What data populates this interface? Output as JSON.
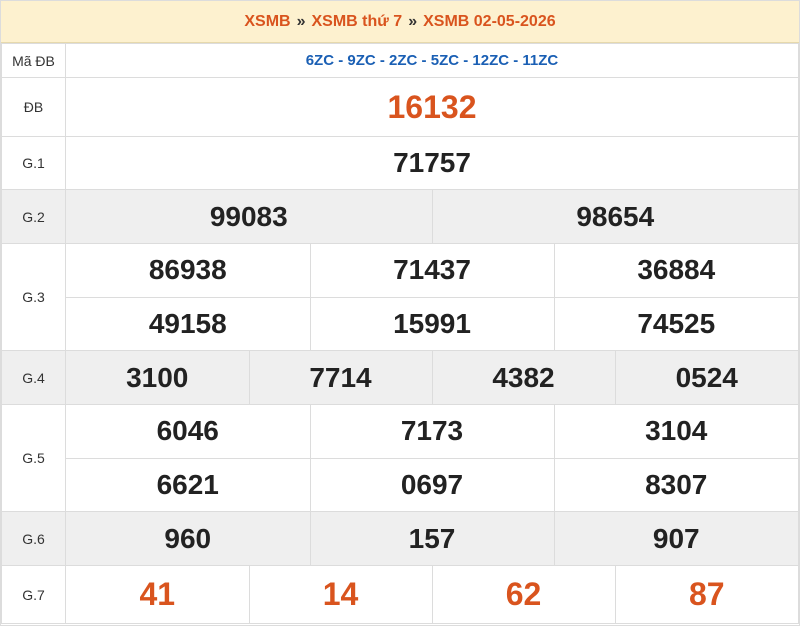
{
  "breadcrumb": {
    "home": "XSMB",
    "sep1": "»",
    "day": "XSMB thứ 7",
    "sep2": "»",
    "date": "XSMB 02-05-2026"
  },
  "rows": {
    "ma_db": {
      "label": "Mã ĐB",
      "value": "6ZC - 9ZC - 2ZC - 5ZC - 12ZC - 11ZC"
    },
    "db": {
      "label": "ĐB",
      "values": [
        "16132"
      ]
    },
    "g1": {
      "label": "G.1",
      "values": [
        "71757"
      ]
    },
    "g2": {
      "label": "G.2",
      "values": [
        "99083",
        "98654"
      ]
    },
    "g3": {
      "label": "G.3",
      "values": [
        "86938",
        "71437",
        "36884",
        "49158",
        "15991",
        "74525"
      ]
    },
    "g4": {
      "label": "G.4",
      "values": [
        "3100",
        "7714",
        "4382",
        "0524"
      ]
    },
    "g5": {
      "label": "G.5",
      "values": [
        "6046",
        "7173",
        "3104",
        "6621",
        "0697",
        "8307"
      ]
    },
    "g6": {
      "label": "G.6",
      "values": [
        "960",
        "157",
        "907"
      ]
    },
    "g7": {
      "label": "G.7",
      "values": [
        "41",
        "14",
        "62",
        "87"
      ]
    }
  },
  "colors": {
    "accent": "#d9541e",
    "code_blue": "#1a5fb4",
    "header_bg": "#fdf1cf",
    "stripe": "#efefef"
  }
}
